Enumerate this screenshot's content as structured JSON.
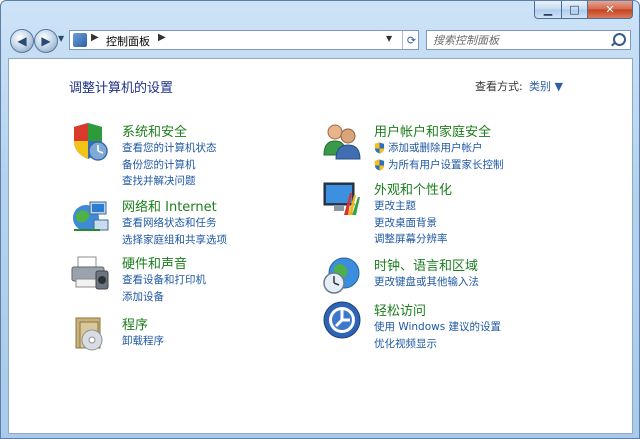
{
  "window": {
    "min_symbol": "▁",
    "max_symbol": "□",
    "close_symbol": "✕"
  },
  "toolbar": {
    "back_symbol": "◀",
    "forward_symbol": "▶",
    "nav_dropdown_symbol": "▼",
    "breadcrumb": "控制面板",
    "breadcrumb_arrow": "▶",
    "address_dropdown_symbol": "▼",
    "refresh_symbol": "⟳",
    "search_placeholder": "搜索控制面板"
  },
  "header": {
    "title": "调整计算机的设置",
    "view_by_label": "查看方式:",
    "view_by_value": "类别 ▼"
  },
  "categories": [
    {
      "title": "系统和安全",
      "links": [
        "查看您的计算机状态",
        "备份您的计算机",
        "查找并解决问题"
      ],
      "icon": "shield-icon"
    },
    {
      "title": "网络和 Internet",
      "links": [
        "查看网络状态和任务",
        "选择家庭组和共享选项"
      ],
      "icon": "network-icon"
    },
    {
      "title": "硬件和声音",
      "links": [
        "查看设备和打印机",
        "添加设备"
      ],
      "icon": "printer-icon"
    },
    {
      "title": "程序",
      "links": [
        "卸载程序"
      ],
      "icon": "programs-icon"
    },
    {
      "title": "用户帐户和家庭安全",
      "links": [
        "添加或删除用户帐户",
        "为所有用户设置家长控制"
      ],
      "icon": "users-icon"
    },
    {
      "title": "外观和个性化",
      "links": [
        "更改主题",
        "更改桌面背景",
        "调整屏幕分辨率"
      ],
      "icon": "display-icon"
    },
    {
      "title": "时钟、语言和区域",
      "links": [
        "更改键盘或其他输入法"
      ],
      "icon": "clock-globe-icon"
    },
    {
      "title": "轻松访问",
      "links": [
        "使用 Windows 建议的设置",
        "优化视频显示"
      ],
      "icon": "accessibility-icon"
    }
  ],
  "colors": {
    "category_title": "#1c7d1c",
    "link": "#1f58a4",
    "page_title": "#1e3287"
  }
}
